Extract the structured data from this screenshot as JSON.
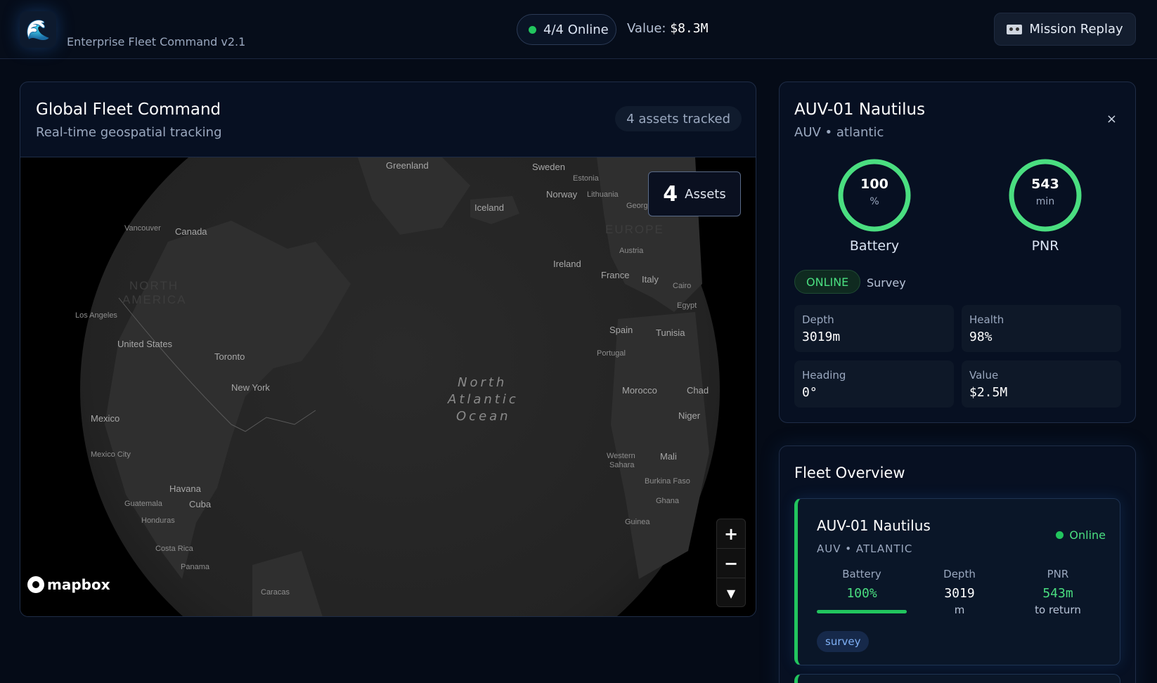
{
  "header": {
    "logo_icon": "wave-emoji",
    "logo_glyph": "🌊",
    "subtitle": "Enterprise Fleet Command v2.1",
    "online_status": "4/4 Online",
    "value_label": "Value:",
    "value_amount": "$8.3M",
    "replay_button": "Mission Replay"
  },
  "map": {
    "title": "Global Fleet Command",
    "subtitle": "Real-time geospatial tracking",
    "tracked_pill": "4 assets tracked",
    "assets_count": "4",
    "assets_label": "Assets",
    "zoom_in": "+",
    "zoom_out": "−",
    "compass": "▼",
    "attribution": "mapbox",
    "labels": {
      "greenland": "Greenland",
      "sweden": "Sweden",
      "estonia": "Estonia",
      "norway": "Norway",
      "lithuania": "Lithuania",
      "georgia": "Georg",
      "iceland": "Iceland",
      "vancouver": "Vancouver",
      "canada": "Canada",
      "europe": "EUROPE",
      "austria": "Austria",
      "ireland": "Ireland",
      "north_america_1": "NORTH",
      "north_america_2": "AMERICA",
      "france": "France",
      "italy": "Italy",
      "cairo": "Cairo",
      "egypt": "Egypt",
      "los_angeles": "Los Angeles",
      "spain": "Spain",
      "tunisia": "Tunisia",
      "united_states": "United States",
      "portugal": "Portugal",
      "toronto": "Toronto",
      "ocean_1": "North",
      "ocean_2": "Atlantic",
      "ocean_3": "Ocean",
      "new_york": "New York",
      "morocco": "Morocco",
      "chad": "Chad",
      "mexico": "Mexico",
      "niger": "Niger",
      "mexico_city": "Mexico City",
      "western_sahara_1": "Western",
      "western_sahara_2": "Sahara",
      "mali": "Mali",
      "burkina_faso": "Burkina Faso",
      "havana": "Havana",
      "guatemala": "Guatemala",
      "cuba": "Cuba",
      "ghana": "Ghana",
      "honduras": "Honduras",
      "guinea": "Guinea",
      "costa_rica": "Costa Rica",
      "panama": "Panama",
      "caracas": "Caracas"
    }
  },
  "detail": {
    "title": "AUV-01 Nautilus",
    "subtitle": "AUV • atlantic",
    "close": "×",
    "battery_value": "100",
    "battery_unit": "%",
    "battery_label": "Battery",
    "battery_fraction": 1.0,
    "pnr_value": "543",
    "pnr_unit": "min",
    "pnr_label": "PNR",
    "pnr_fraction": 1.0,
    "status": "ONLINE",
    "mode": "Survey",
    "stats": [
      {
        "label": "Depth",
        "value": "3019m"
      },
      {
        "label": "Health",
        "value": "98%"
      },
      {
        "label": "Heading",
        "value": "0°"
      },
      {
        "label": "Value",
        "value": "$2.5M"
      }
    ]
  },
  "fleet": {
    "title": "Fleet Overview",
    "cards": [
      {
        "name": "AUV-01 Nautilus",
        "type": "AUV • ATLANTIC",
        "status": "Online",
        "battery_label": "Battery",
        "battery_value": "100%",
        "battery_fraction": 1.0,
        "depth_label": "Depth",
        "depth_value": "3019",
        "depth_unit": "m",
        "pnr_label": "PNR",
        "pnr_value": "543m",
        "pnr_sub": "to return",
        "tag": "survey"
      }
    ]
  },
  "colors": {
    "accent_green": "#22c55e",
    "text_green": "#4ade80",
    "background": "#050b17",
    "panel": "#071022"
  }
}
